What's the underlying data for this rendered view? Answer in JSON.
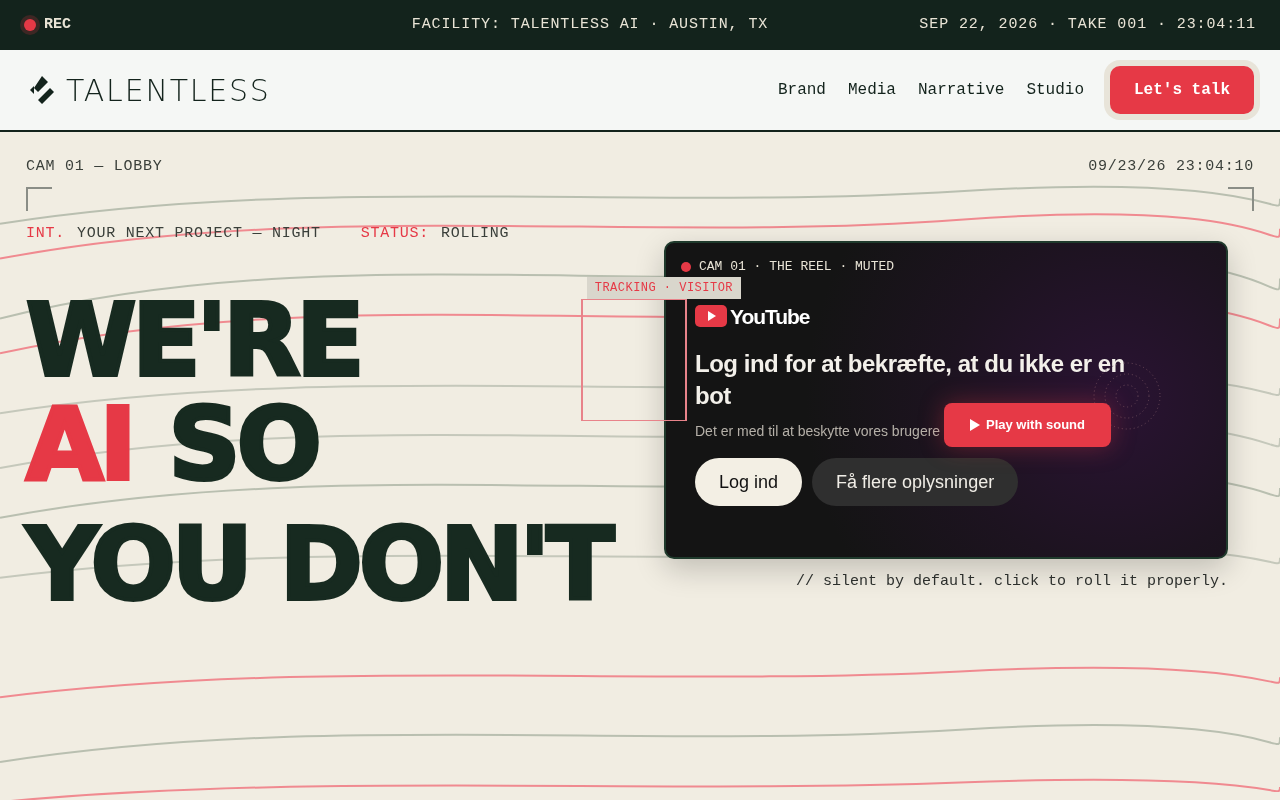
{
  "top_bar": {
    "rec": {
      "label": "REC",
      "recording": true
    },
    "facility": "FACILITY: TALENTLESS AI · AUSTIN, TX",
    "slate": "SEP 22, 2026 · TAKE 001 · 23:04:11"
  },
  "nav": {
    "logo": "TALENTLESS",
    "links": [
      "Brand",
      "Media",
      "Narrative",
      "Studio"
    ],
    "cta": "Let's talk"
  },
  "hero": {
    "camera": "CAM 01 — LOBBY",
    "timestamp": "09/23/26 23:04:10",
    "scene": [
      {
        "kind": "key",
        "text": "INT."
      },
      {
        "kind": "value",
        "text": "YOUR NEXT PROJECT — NIGHT"
      },
      {
        "kind": "key",
        "text": "STATUS:"
      },
      {
        "kind": "value",
        "text": "ROLLING"
      }
    ],
    "headline": [
      [
        {
          "text": "WE'RE",
          "accent": false
        }
      ],
      [
        {
          "text": "AI",
          "accent": true
        },
        {
          "text": "SO",
          "accent": false
        }
      ],
      [
        {
          "text": "YOU DON'T",
          "accent": false
        }
      ]
    ],
    "tracking_label": "TRACKING · VISITOR",
    "video": {
      "label": "CAM 01 · THE REEL · MUTED",
      "brand": "YouTube",
      "title": "Log ind for at bekræfte, at du ikke er en bot",
      "subtitle": "Det er med til at beskytte vores brugere",
      "buttons": [
        "Log ind",
        "Få flere oplysninger"
      ],
      "play": "Play with sound"
    },
    "caption": "// silent by default. click to roll it properly."
  }
}
